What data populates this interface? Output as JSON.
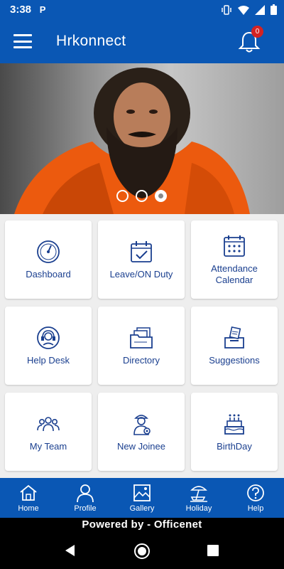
{
  "status_bar": {
    "time": "3:38",
    "notification_letter": "P"
  },
  "app_bar": {
    "title": "Hrkonnect",
    "notification_count": "0"
  },
  "banner": {
    "slide_count": 3,
    "active_slide": 3
  },
  "tiles": [
    {
      "label": "Dashboard",
      "icon": "gauge-icon"
    },
    {
      "label": "Leave/ON Duty",
      "icon": "calendar-check-icon"
    },
    {
      "label": "Attendance Calendar",
      "icon": "calendar-grid-icon"
    },
    {
      "label": "Help Desk",
      "icon": "headset-icon"
    },
    {
      "label": "Directory",
      "icon": "folder-directory-icon"
    },
    {
      "label": "Suggestions",
      "icon": "suggestion-box-icon"
    },
    {
      "label": "My Team",
      "icon": "team-icon"
    },
    {
      "label": "New Joinee",
      "icon": "new-joinee-icon"
    },
    {
      "label": "BirthDay",
      "icon": "birthday-cake-icon"
    }
  ],
  "bottom_nav": [
    {
      "label": "Home",
      "icon": "home-icon"
    },
    {
      "label": "Profile",
      "icon": "profile-icon"
    },
    {
      "label": "Gallery",
      "icon": "gallery-icon"
    },
    {
      "label": "Holiday",
      "icon": "holiday-icon"
    },
    {
      "label": "Help",
      "icon": "help-icon"
    }
  ],
  "footer": {
    "powered_by": "Powered by - Officenet"
  },
  "colors": {
    "primary": "#0a57b4",
    "tile_text": "#1a3f8f",
    "badge": "#d32222"
  }
}
